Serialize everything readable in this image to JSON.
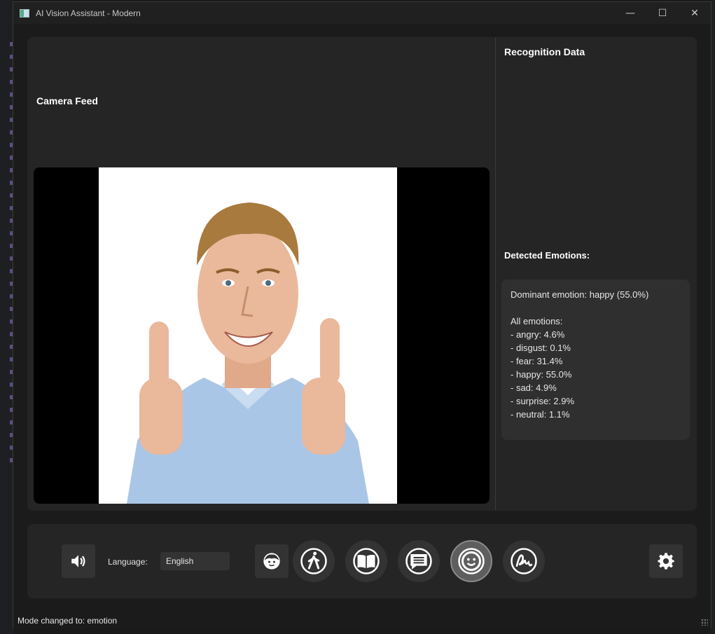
{
  "window": {
    "title": "AI Vision Assistant - Modern",
    "controls": {
      "minimize": "—",
      "maximize": "☐",
      "close": "✕"
    }
  },
  "main": {
    "camera_title": "Camera Feed",
    "recognition_title": "Recognition Data",
    "emotions_title": "Detected Emotions:",
    "emotions_text": [
      "Dominant emotion: happy (55.0%)",
      "",
      "All emotions:",
      "- angry: 4.6%",
      "- disgust: 0.1%",
      "- fear: 31.4%",
      "- happy: 55.0%",
      "- sad: 4.9%",
      "- surprise: 2.9%",
      "- neutral: 1.1%"
    ]
  },
  "controls": {
    "speaker_icon": "speaker-icon",
    "language_label": "Language:",
    "language_value": "English",
    "modes": [
      {
        "name": "face-mode",
        "icon": "face-icon"
      },
      {
        "name": "walk-mode",
        "icon": "walking-person-icon"
      },
      {
        "name": "read-mode",
        "icon": "book-icon"
      },
      {
        "name": "text-mode",
        "icon": "chat-text-icon"
      },
      {
        "name": "emotion-mode",
        "icon": "smiley-icon",
        "active": true
      },
      {
        "name": "sign-mode",
        "icon": "signature-icon"
      }
    ],
    "settings_icon": "gear-icon"
  },
  "status": {
    "message": "Mode changed to: emotion"
  }
}
